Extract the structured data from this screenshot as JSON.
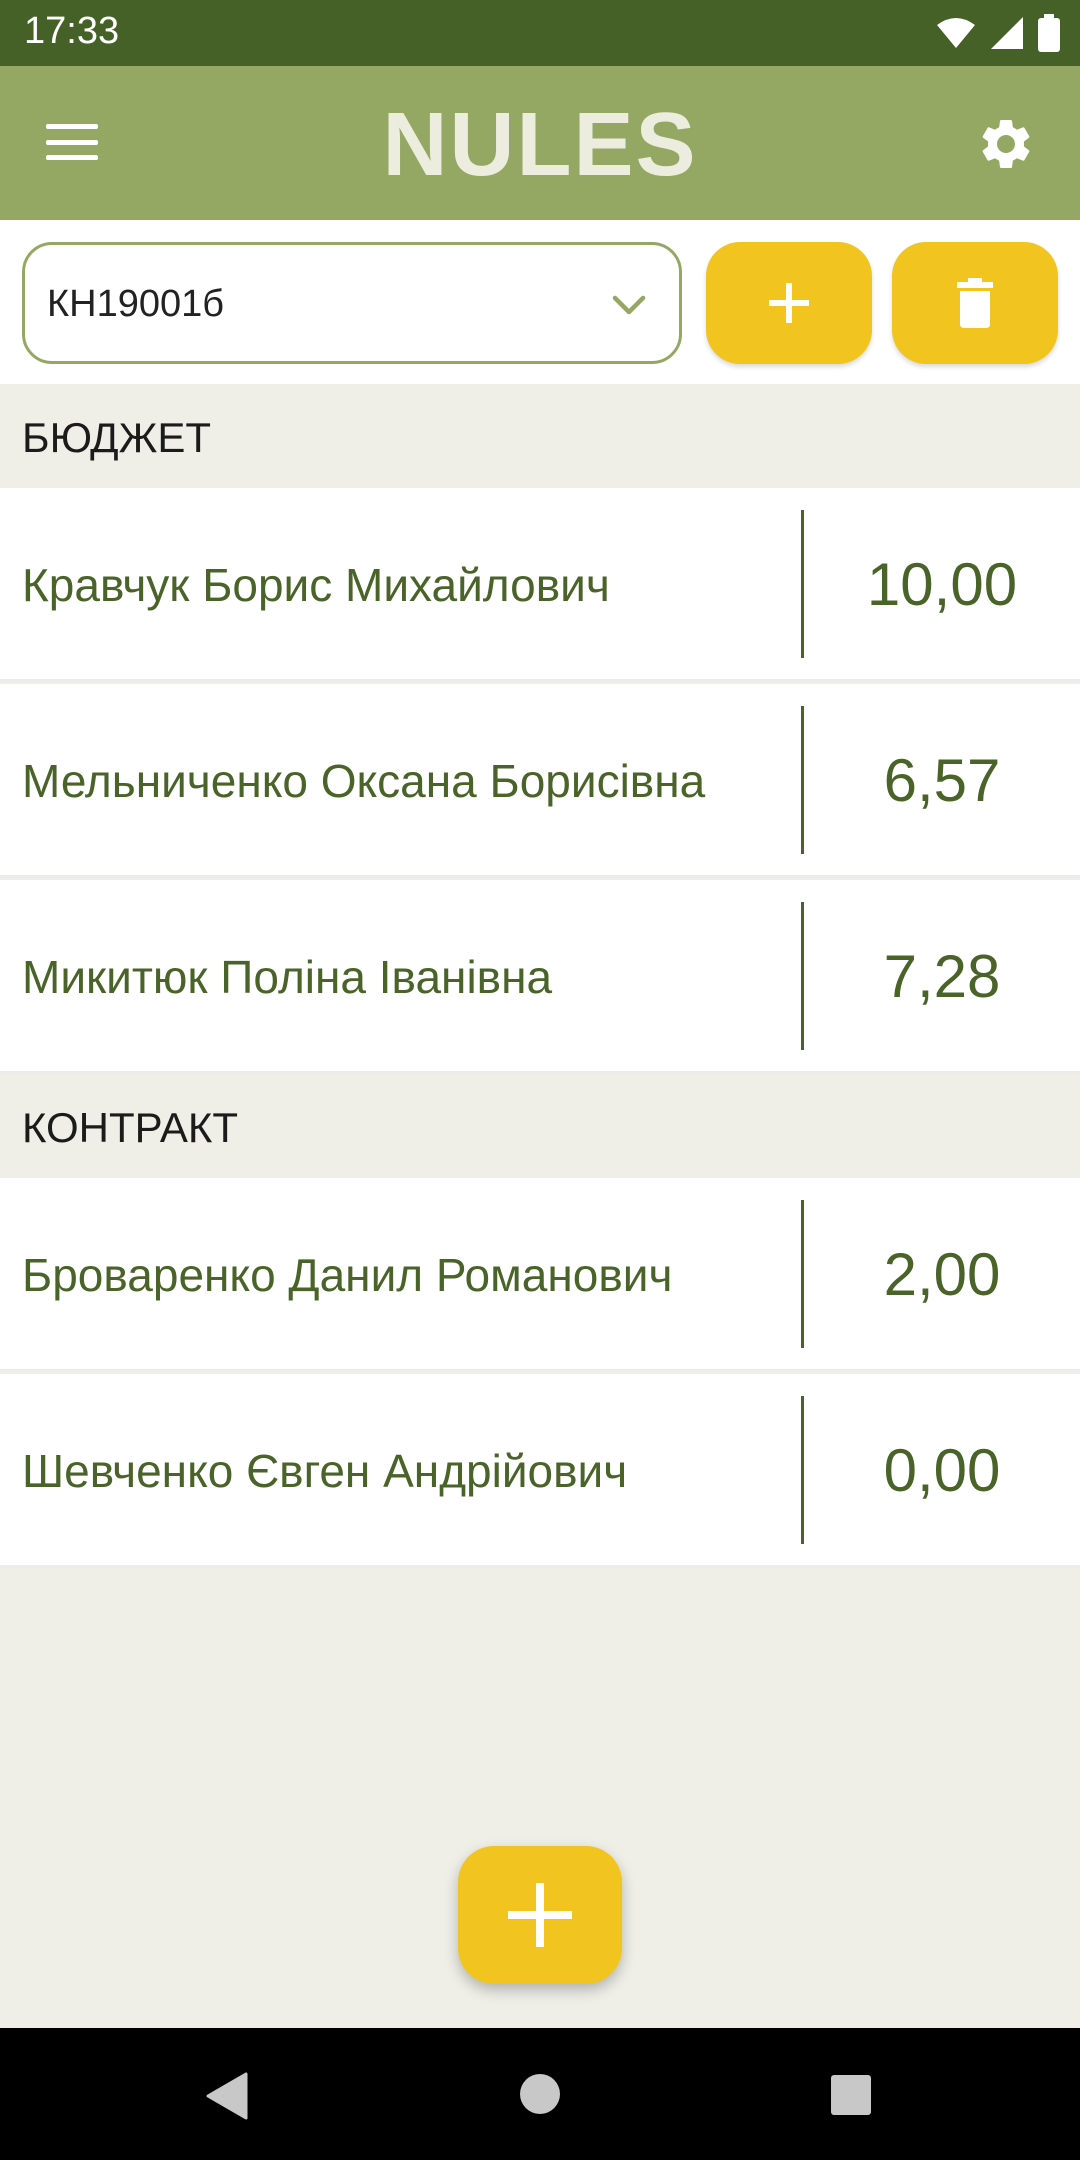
{
  "status_bar": {
    "time": "17:33"
  },
  "app_bar": {
    "title": "NULES"
  },
  "group_selector": {
    "value": "КН19001б"
  },
  "sections": [
    {
      "title": "БЮДЖЕТ",
      "students": [
        {
          "name": "Кравчук Борис Михайлович",
          "score": "10,00"
        },
        {
          "name": "Мельниченко Оксана Борисівна",
          "score": "6,57"
        },
        {
          "name": "Микитюк Поліна Іванівна",
          "score": "7,28"
        }
      ]
    },
    {
      "title": "КОНТРАКТ",
      "students": [
        {
          "name": "Броваренко Данил Романович",
          "score": "2,00"
        },
        {
          "name": "Шевченко Євген Андрійович",
          "score": "0,00"
        }
      ]
    }
  ],
  "colors": {
    "status_bar": "#456128",
    "app_bar": "#94a864",
    "accent": "#f1c41f",
    "text_green": "#4a6329",
    "background": "#efefe8"
  },
  "icons": {
    "menu": "menu-icon",
    "settings": "gear-icon",
    "dropdown": "chevron-down-icon",
    "add": "plus-icon",
    "delete": "trash-icon"
  }
}
